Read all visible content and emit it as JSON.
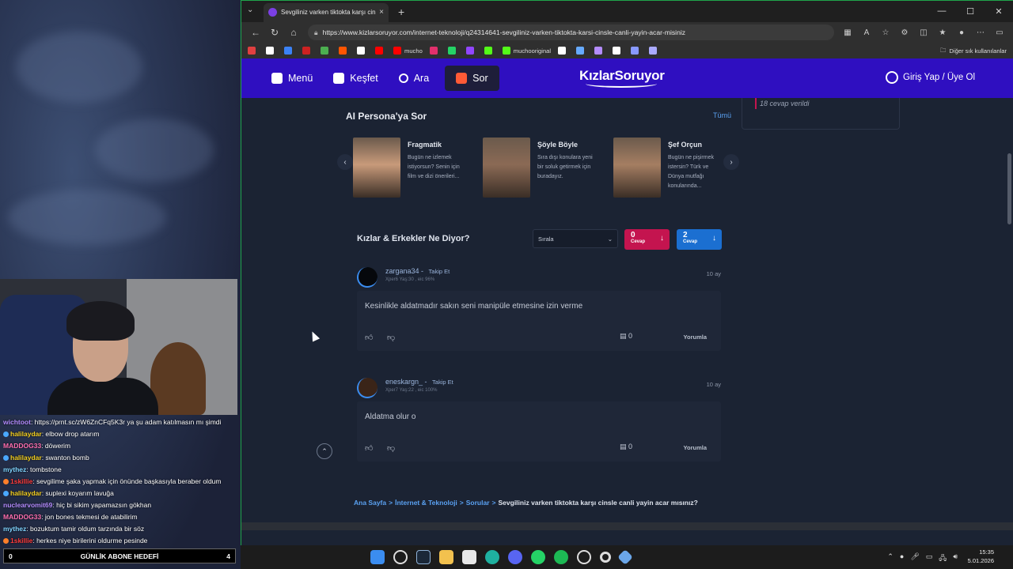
{
  "stream": {
    "chat": [
      {
        "user": "wichtoot",
        "msg": ": https://prnt.sc/zW6ZnCFq5K3r ya şu adam katılmasın mı şimdi",
        "color": "#b48cff",
        "badge": ""
      },
      {
        "user": "halilaydar",
        "msg": ": elbow drop atarım",
        "color": "#f5d020",
        "badge": "#4aa8ff"
      },
      {
        "user": "MADDOG33",
        "msg": ": döwerim",
        "color": "#ff6fb0",
        "badge": ""
      },
      {
        "user": "halilaydar",
        "msg": ": swanton bomb",
        "color": "#f5d020",
        "badge": "#4aa8ff"
      },
      {
        "user": "mythez",
        "msg": ": tombstone",
        "color": "#7fd4ff",
        "badge": ""
      },
      {
        "user": "1skillie",
        "msg": ": sevgilime şaka yapmak için önünde başkasıyla beraber oldum",
        "color": "#ff3b3b",
        "badge": "#ff7f2a"
      },
      {
        "user": "halilaydar",
        "msg": ": suplexi koyarım lavuğa",
        "color": "#f5d020",
        "badge": "#4aa8ff"
      },
      {
        "user": "nuclearvomit69",
        "msg": ": hiç bi sikim yapamazsın gökhan",
        "color": "#b48cff",
        "badge": ""
      },
      {
        "user": "MADDOG33",
        "msg": ": jon bones tekmesi de atabilirim",
        "color": "#ff6fb0",
        "badge": ""
      },
      {
        "user": "mythez",
        "msg": ": bozuktum tamir oldum tarzında bir söz",
        "color": "#7fd4ff",
        "badge": ""
      },
      {
        "user": "1skillie",
        "msg": ": herkes niye birilerini oldurme pesinde",
        "color": "#ff3b3b",
        "badge": "#ff7f2a"
      }
    ],
    "goal": {
      "left": "0",
      "label": "GÜNLİK ABONE HEDEFİ",
      "right": "4"
    }
  },
  "browser": {
    "tab_title": "Sevgiliniz varken tiktokta karşı cinsle canlı yayın acar mısınız",
    "tab_close": "×",
    "new_tab": "+",
    "url": "https://www.kizlarsoruyor.com/internet-teknoloji/q24314641-sevgiliniz-varken-tiktokta-karsi-cinsle-canli-yayin-acar-misiniz",
    "bookmarks": [
      {
        "label": "",
        "color": "#e04040"
      },
      {
        "label": "",
        "color": "#ffffff"
      },
      {
        "label": "",
        "color": "#3b82f6"
      },
      {
        "label": "",
        "color": "#c22"
      },
      {
        "label": "",
        "color": "#4caf50"
      },
      {
        "label": "",
        "color": "#ff5500"
      },
      {
        "label": "",
        "color": "#ffffff"
      },
      {
        "label": "",
        "color": "#ff0000"
      },
      {
        "label": "mucho",
        "color": "#ff0000"
      },
      {
        "label": "",
        "color": "#e1306c"
      },
      {
        "label": "",
        "color": "#25d366"
      },
      {
        "label": "",
        "color": "#9146ff"
      },
      {
        "label": "",
        "color": "#53fc18"
      },
      {
        "label": "muchooriginal",
        "color": "#53fc18"
      },
      {
        "label": "",
        "color": "#ffffff"
      },
      {
        "label": "",
        "color": "#66aaff"
      },
      {
        "label": "",
        "color": "#b48cff"
      },
      {
        "label": "",
        "color": "#ffffff"
      },
      {
        "label": "",
        "color": "#8899ff"
      },
      {
        "label": "",
        "color": "#aaaaff"
      }
    ],
    "other_bookmarks": "Diğer sık kullanılanlar"
  },
  "site": {
    "nav": {
      "menu": "Menü",
      "explore": "Keşfet",
      "search": "Ara",
      "ask": "Sor"
    },
    "logo": "KızlarSoruyor",
    "login": "Giriş Yap / Üye Ol",
    "side_card_text": "18 cevap verildi",
    "ai_section": {
      "title": "AI Persona'ya Sor",
      "all": "Tümü",
      "personas": [
        {
          "name": "Fragmatik",
          "desc": "Bugün ne izlemek istiyorsun? Senin için film ve dizi önerileri...",
          "color": "#c89a7a"
        },
        {
          "name": "Şöyle Böyle",
          "desc": "Sıra dışı konulara yeni bir soluk getirmek için buradayız.",
          "color": "#8b6a55"
        },
        {
          "name": "Şef Orçun",
          "desc": "Bugün ne pişirmek istersin? Türk ve Dünya mutfağı konularında...",
          "color": "#a57e62"
        }
      ]
    },
    "answers_section": {
      "title": "Kızlar & Erkekler Ne Diyor?",
      "sort_label": "Sırala",
      "girls": {
        "count": "0",
        "label": "Cevap",
        "color": "#c4144f"
      },
      "guys": {
        "count": "2",
        "label": "Cevap",
        "color": "#1b6fd1"
      }
    },
    "answers": [
      {
        "user": "zargana34",
        "follow": "Takip Et",
        "meta": "Xper6 Yaş:30 , eic 96%",
        "ago": "10 ay",
        "text": "Kesinlikle aldatmadır sakın seni manipüle etmesine izin verme",
        "comments": "0",
        "reply": "Yorumla"
      },
      {
        "user": "eneskargn_",
        "follow": "Takip Et",
        "meta": "Xper7 Yaş:22 , eic 100%",
        "ago": "10 ay",
        "text": "Aldatma olur o",
        "comments": "0",
        "reply": "Yorumla"
      }
    ],
    "breadcrumb": {
      "items": [
        "Ana Sayfa",
        "İnternet & Teknoloji",
        "Sorular"
      ],
      "current": "Sevgiliniz varken tiktokta karşı cinsle canli yayin acar mısınız?"
    }
  },
  "taskbar": {
    "time": "15:35",
    "date": "5.01.2026"
  }
}
